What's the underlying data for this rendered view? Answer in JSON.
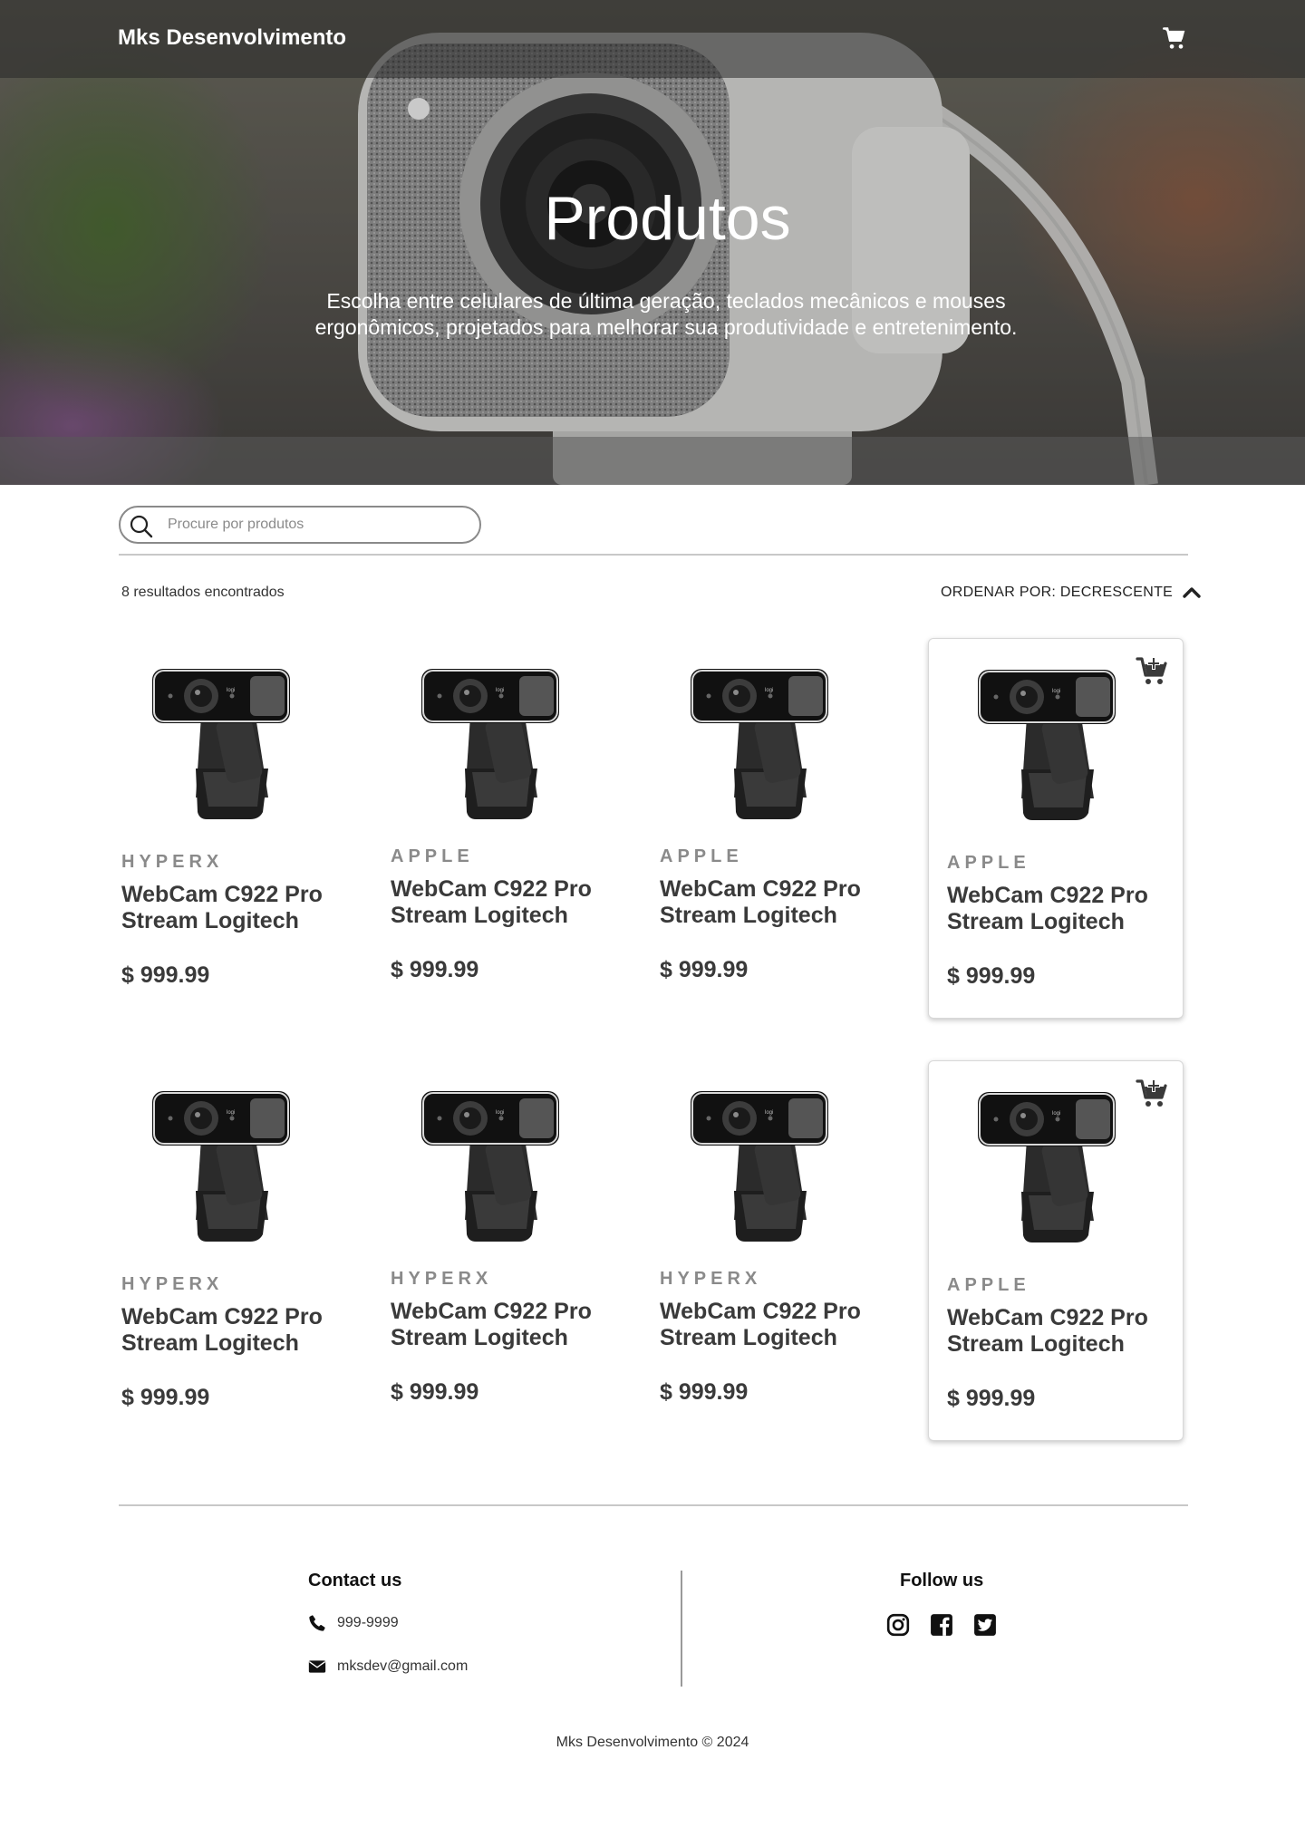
{
  "header": {
    "brand": "Mks Desenvolvimento",
    "cart_icon": "shopping-cart-icon"
  },
  "hero": {
    "title": "Produtos",
    "subtitle": "Escolha entre celulares de última geração, teclados mecânicos e mouses ergonômicos, projetados para melhorar sua produtividade e entretenimento.",
    "background_image": "webcam-photo"
  },
  "search": {
    "placeholder": "Procure por produtos",
    "value": "",
    "icon": "search-icon"
  },
  "listing": {
    "results_text": "8 resultados encontrados",
    "sort_label": "ORDENAR POR: DECRESCENTE",
    "sort_icon": "chevron-up-icon"
  },
  "products": [
    {
      "brand": "HYPERX",
      "name": "WebCam C922 Pro Stream Logitech",
      "price": "$ 999.99",
      "image": "webcam-image",
      "highlighted": false
    },
    {
      "brand": "APPLE",
      "name": "WebCam C922 Pro Stream Logitech",
      "price": "$ 999.99",
      "image": "webcam-image",
      "highlighted": false
    },
    {
      "brand": "APPLE",
      "name": "WebCam C922 Pro Stream Logitech",
      "price": "$ 999.99",
      "image": "webcam-image",
      "highlighted": false
    },
    {
      "brand": "APPLE",
      "name": "WebCam C922 Pro Stream Logitech",
      "price": "$ 999.99",
      "image": "webcam-image",
      "highlighted": true,
      "action_icon": "add-to-cart-icon"
    },
    {
      "brand": "HYPERX",
      "name": "WebCam C922 Pro Stream Logitech",
      "price": "$ 999.99",
      "image": "webcam-image",
      "highlighted": false
    },
    {
      "brand": "HYPERX",
      "name": "WebCam C922 Pro Stream Logitech",
      "price": "$ 999.99",
      "image": "webcam-image",
      "highlighted": false
    },
    {
      "brand": "HYPERX",
      "name": "WebCam C922 Pro Stream Logitech",
      "price": "$ 999.99",
      "image": "webcam-image",
      "highlighted": false
    },
    {
      "brand": "APPLE",
      "name": "WebCam C922 Pro Stream Logitech",
      "price": "$ 999.99",
      "image": "webcam-image",
      "highlighted": true,
      "action_icon": "add-to-cart-icon"
    }
  ],
  "footer": {
    "contact_title": "Contact us",
    "phone": "999-9999",
    "phone_icon": "phone-icon",
    "email": "mksdev@gmail.com",
    "email_icon": "envelope-icon",
    "follow_title": "Follow us",
    "social_icons": [
      "instagram-icon",
      "facebook-icon",
      "twitter-icon"
    ],
    "copyright": "Mks Desenvolvimento © 2024"
  },
  "colors": {
    "text_dark": "#3a3a3a",
    "brand_gray": "#8a8a8a",
    "divider": "#c8c8c8",
    "white": "#ffffff"
  }
}
